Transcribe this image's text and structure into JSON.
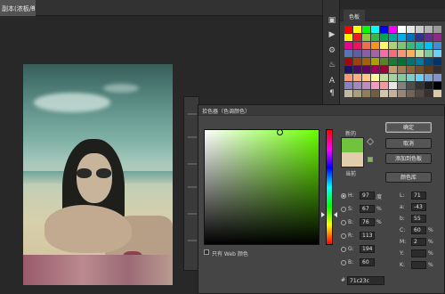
{
  "document": {
    "tab_title": "副本(浓板/8) *",
    "close_glyph": "×"
  },
  "swatches_panel": {
    "tab_label": "色板",
    "rows": [
      [
        "#ff0000",
        "#ffff00",
        "#00ff00",
        "#00ffff",
        "#0000ff",
        "#ff00ff",
        "#ffffff",
        "#e6e6e6",
        "#cccccc",
        "#b3b3b3",
        "#999999"
      ],
      [
        "#fff200",
        "#ed1c24",
        "#8dc63f",
        "#39b54a",
        "#00a651",
        "#00a99d",
        "#00aeef",
        "#0072bc",
        "#2e3192",
        "#662d91",
        "#92278f"
      ],
      [
        "#ec008c",
        "#ed145b",
        "#f26c4f",
        "#f7941d",
        "#fff568",
        "#acd373",
        "#7cc576",
        "#3bb878",
        "#1abbb4",
        "#00bff3",
        "#448ccb"
      ],
      [
        "#5674b9",
        "#605ca8",
        "#8560a8",
        "#a763a8",
        "#f06eaa",
        "#f26d7d",
        "#f69679",
        "#fbaf5d",
        "#c4df9b",
        "#82ca9c",
        "#6dcff6"
      ],
      [
        "#9e0b0f",
        "#a0410d",
        "#a36209",
        "#aba000",
        "#598527",
        "#1a7b30",
        "#007236",
        "#00746b",
        "#0076a3",
        "#004b80",
        "#003471"
      ],
      [
        "#1b1464",
        "#440e62",
        "#630460",
        "#9e005d",
        "#9e0039",
        "#c69c6d",
        "#a67c52",
        "#8c6239",
        "#754c24",
        "#603913",
        "#362f2d"
      ],
      [
        "#f7977a",
        "#f9ad81",
        "#fdc68a",
        "#fff79a",
        "#c4df9b",
        "#a3d39c",
        "#82ca9d",
        "#7bcdc8",
        "#6ecff6",
        "#7ea7d8",
        "#8493ca"
      ],
      [
        "#8882be",
        "#a187be",
        "#bc8dbf",
        "#f49ac2",
        "#f6989d",
        "#e6e6e6",
        "#808080",
        "#4d4d4d",
        "#333333",
        "#1a1a1a",
        "#000000"
      ],
      [
        "#c2b9a3",
        "#ad9d7e",
        "#8f7d5c",
        "#6f5e3f",
        "#d4c7a9",
        "#c7b299",
        "#998675",
        "#736357",
        "#534741",
        "#37302d",
        "#dbc9a8"
      ]
    ]
  },
  "toolbar": {
    "icons": [
      "layers-icon",
      "play-icon",
      "settings-icon",
      "brush-icon",
      "type-icon",
      "paragraph-icon"
    ],
    "glyphs": [
      "▣",
      "▶",
      "⚙",
      "♨",
      "A",
      "¶"
    ]
  },
  "color_picker": {
    "title": "拾色器（色调颜色）",
    "label_new": "新的",
    "label_current": "当前",
    "new_color": "#71c23c",
    "current_color": "#e1ccab",
    "hue_color": "#6aff00",
    "buttons": {
      "ok": "确定",
      "cancel": "取消",
      "add_to_swatches": "添加到色板",
      "color_libraries": "颜色库"
    },
    "fields_hsb_rgb": [
      {
        "label": "H:",
        "value": "97",
        "unit": "度",
        "selected": true
      },
      {
        "label": "S:",
        "value": "67",
        "unit": "%",
        "selected": false
      },
      {
        "label": "B:",
        "value": "76",
        "unit": "%",
        "selected": false
      },
      {
        "label": "R:",
        "value": "113",
        "unit": "",
        "selected": false
      },
      {
        "label": "G:",
        "value": "194",
        "unit": "",
        "selected": false
      },
      {
        "label": "B:",
        "value": "60",
        "unit": "",
        "selected": false
      }
    ],
    "fields_lab_cmyk": [
      {
        "label": "L:",
        "value": "71",
        "unit": ""
      },
      {
        "label": "a:",
        "value": "-43",
        "unit": ""
      },
      {
        "label": "b:",
        "value": "55",
        "unit": ""
      },
      {
        "label": "C:",
        "value": "60",
        "unit": "%"
      },
      {
        "label": "M:",
        "value": "2",
        "unit": "%"
      },
      {
        "label": "Y:",
        "value": "",
        "unit": "%"
      },
      {
        "label": "K:",
        "value": "",
        "unit": "%"
      }
    ],
    "hex_label": "#",
    "hex_value": "71c23c",
    "websafe_label": "只有 Web 颜色"
  }
}
